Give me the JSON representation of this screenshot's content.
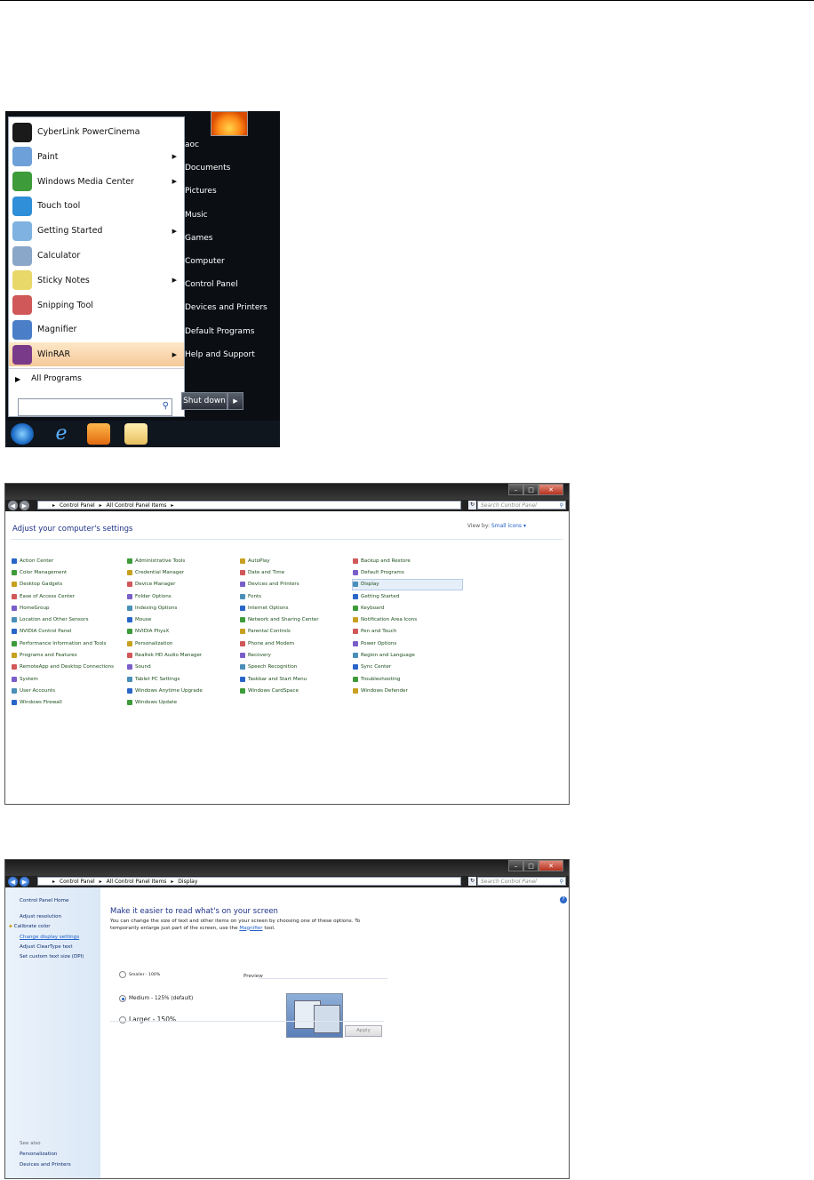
{
  "start_menu": {
    "programs": [
      {
        "label": "CyberLink PowerCinema",
        "icon": "cyberlink-icon",
        "color": "#1a1a1a",
        "has_arrow": false
      },
      {
        "label": "Paint",
        "icon": "paint-icon",
        "color": "#6da0d8",
        "has_arrow": true
      },
      {
        "label": "Windows Media Center",
        "icon": "media-center-icon",
        "color": "#3d9b3a",
        "has_arrow": true
      },
      {
        "label": "Touch tool",
        "icon": "touch-tool-icon",
        "color": "#2f8fd8",
        "has_arrow": false
      },
      {
        "label": "Getting Started",
        "icon": "getting-started-icon",
        "color": "#7fb2e0",
        "has_arrow": true
      },
      {
        "label": "Calculator",
        "icon": "calculator-icon",
        "color": "#8aa6c8",
        "has_arrow": false
      },
      {
        "label": "Sticky Notes",
        "icon": "sticky-notes-icon",
        "color": "#e8d86a",
        "has_arrow": true
      },
      {
        "label": "Snipping Tool",
        "icon": "snipping-tool-icon",
        "color": "#d05858",
        "has_arrow": false
      },
      {
        "label": "Magnifier",
        "icon": "magnifier-icon",
        "color": "#4a7fc8",
        "has_arrow": false
      },
      {
        "label": "WinRAR",
        "icon": "winrar-icon",
        "color": "#7a3a8a",
        "has_arrow": true
      }
    ],
    "all_programs": "All Programs",
    "search_placeholder": "",
    "right_items": [
      "aoc",
      "Documents",
      "Pictures",
      "Music",
      "Games",
      "Computer",
      "Control Panel",
      "Devices and Printers",
      "Default Programs",
      "Help and Support"
    ],
    "shutdown_label": "Shut down",
    "taskbar_icons": [
      "start-orb-icon",
      "internet-explorer-icon",
      "media-player-icon",
      "explorer-folder-icon"
    ]
  },
  "window1": {
    "breadcrumb": [
      "Control Panel",
      "All Control Panel Items"
    ],
    "search_placeholder": "Search Control Panel",
    "heading": "Adjust your computer's settings",
    "view_by_label": "View by:",
    "view_by_value": "Small icons",
    "columns": [
      [
        "Action Center",
        "Color Management",
        "Desktop Gadgets",
        "Ease of Access Center",
        "HomeGroup",
        "Location and Other Sensors",
        "NVIDIA Control Panel",
        "Performance Information and Tools",
        "Programs and Features",
        "RemoteApp and Desktop Connections",
        "System",
        "User Accounts",
        "Windows Firewall"
      ],
      [
        "Administrative Tools",
        "Credential Manager",
        "Device Manager",
        "Folder Options",
        "Indexing Options",
        "Mouse",
        "NVIDIA PhysX",
        "Personalization",
        "Realtek HD Audio Manager",
        "Sound",
        "Tablet PC Settings",
        "Windows Anytime Upgrade",
        "Windows Update"
      ],
      [
        "AutoPlay",
        "Date and Time",
        "Devices and Printers",
        "Fonts",
        "Internet Options",
        "Network and Sharing Center",
        "Parental Controls",
        "Phone and Modem",
        "Recovery",
        "Speech Recognition",
        "Taskbar and Start Menu",
        "Windows CardSpace"
      ],
      [
        "Backup and Restore",
        "Default Programs",
        "Display",
        "Getting Started",
        "Keyboard",
        "Notification Area Icons",
        "Pen and Touch",
        "Power Options",
        "Region and Language",
        "Sync Center",
        "Troubleshooting",
        "Windows Defender"
      ]
    ],
    "selected_item": "Display"
  },
  "window2": {
    "breadcrumb": [
      "Control Panel",
      "All Control Panel Items",
      "Display"
    ],
    "search_placeholder": "Search Control Panel",
    "sidebar_links": [
      "Control Panel Home",
      "Adjust resolution",
      "Calibrate color",
      "Change display settings",
      "Adjust ClearType text",
      "Set custom text size (DPI)"
    ],
    "see_also_label": "See also",
    "see_also_links": [
      "Personalization",
      "Devices and Printers"
    ],
    "title": "Make it easier to read what's on your screen",
    "desc_pre": "You can change the size of text and other items on your screen by choosing one of these options. To temporarily enlarge just part of the screen, use the ",
    "desc_link": "Magnifier",
    "desc_post": " tool.",
    "options": [
      {
        "label": "Smaller - 100%",
        "selected": false
      },
      {
        "label": "Medium - 125% (default)",
        "selected": true
      },
      {
        "label": "Larger - 150%",
        "selected": false
      }
    ],
    "preview_label": "Preview",
    "apply_label": "Apply"
  }
}
